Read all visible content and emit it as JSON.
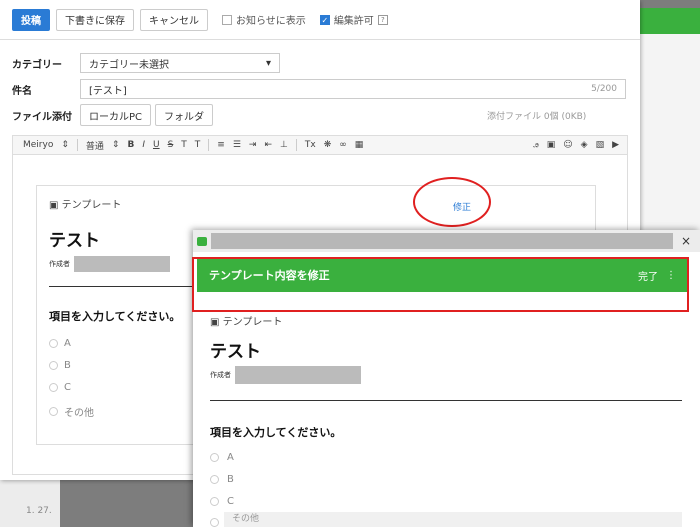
{
  "topbar": {
    "post": "投稿",
    "save_draft": "下書きに保存",
    "cancel": "キャンセル",
    "notice": "お知らせに表示",
    "edit_allowed": "編集許可",
    "help": "?"
  },
  "form": {
    "category_label": "カテゴリー",
    "category_value": "カテゴリー未選択",
    "title_label": "件名",
    "title_value": "[テスト]",
    "title_count": "5/200",
    "attach_label": "ファイル添付",
    "local_pc": "ローカルPC",
    "folder": "フォルダ",
    "attach_info": "添付ファイル 0個 (0KB)"
  },
  "format_toolbar": {
    "font": "Meiryo",
    "size": "普通",
    "bold": "B",
    "italic": "I",
    "underline": "U",
    "strike": "S",
    "text_color": "T",
    "bg_color": "T",
    "clear_format": "Tx"
  },
  "template": {
    "header": "テンプレート",
    "edit_link": "修正",
    "title": "テスト",
    "author_label": "作成者",
    "question": "項目を入力してください。",
    "options": [
      "A",
      "B",
      "C",
      "その他"
    ]
  },
  "modal": {
    "close": "×",
    "bar_title": "テンプレート内容を修正",
    "done": "完了",
    "more": "⋮",
    "header": "テンプレート",
    "title": "テスト",
    "author_label": "作成者",
    "question": "項目を入力してください。",
    "options": [
      "A",
      "B",
      "C"
    ],
    "other": "その他"
  },
  "background": {
    "line_number": "1. 27."
  },
  "colors": {
    "primary": "#2a7bd5",
    "green": "#3ab03e",
    "highlight_red": "#e02020"
  }
}
